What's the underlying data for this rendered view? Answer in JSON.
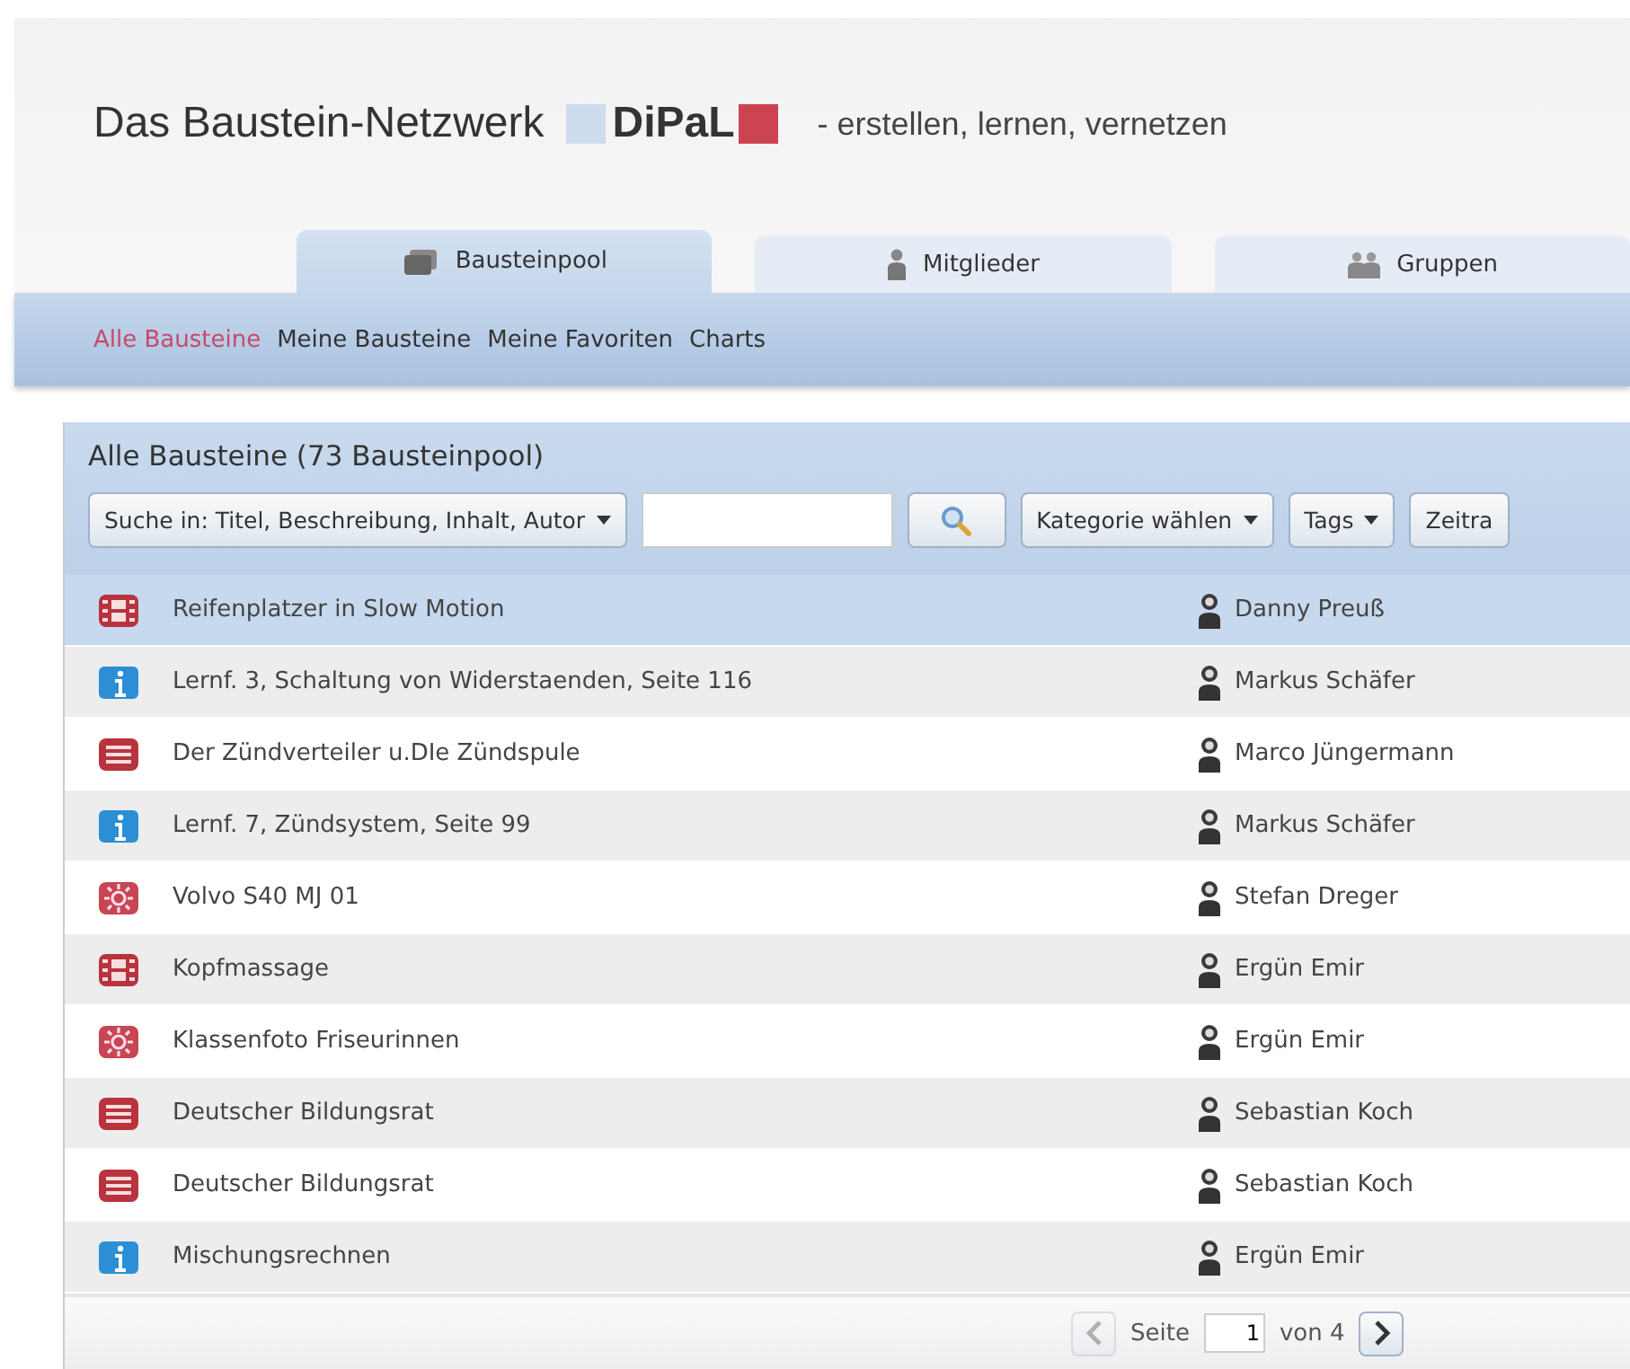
{
  "header": {
    "title": "Das Baustein-Netzwerk",
    "logo": "DiPaL",
    "slogan": "- erstellen, lernen, vernetzen"
  },
  "tabs": [
    {
      "label": "Bausteinpool",
      "kind": "pool",
      "selected": true
    },
    {
      "label": "Mitglieder",
      "kind": "member",
      "selected": false
    },
    {
      "label": "Gruppen",
      "kind": "group",
      "selected": false
    }
  ],
  "subnav": [
    {
      "label": "Alle Bausteine",
      "selected": true
    },
    {
      "label": "Meine Bausteine",
      "selected": false
    },
    {
      "label": "Meine Favoriten",
      "selected": false
    },
    {
      "label": "Charts",
      "selected": false
    }
  ],
  "panel": {
    "title": "Alle Bausteine (73 Bausteinpool)",
    "toolbar": {
      "search_scope": "Suche in: Titel, Beschreibung, Inhalt, Autor",
      "category": "Kategorie wählen",
      "tags": "Tags",
      "cut_button": "Zeitra"
    },
    "rows": [
      {
        "kind": "video",
        "title": "Reifenplatzer in Slow Motion",
        "author": "Danny Preuß",
        "selected": true
      },
      {
        "kind": "info",
        "title": "Lernf. 3, Schaltung von Widerstaenden, Seite 116",
        "author": "Markus Schäfer",
        "selected": false
      },
      {
        "kind": "text",
        "title": "Der Zündverteiler u.DIe Zündspule",
        "author": "Marco Jüngermann",
        "selected": false
      },
      {
        "kind": "info",
        "title": "Lernf. 7, Zündsystem, Seite 99",
        "author": "Markus Schäfer",
        "selected": false
      },
      {
        "kind": "image",
        "title": "Volvo S40 MJ 01",
        "author": "Stefan Dreger",
        "selected": false
      },
      {
        "kind": "video",
        "title": "Kopfmassage",
        "author": "Ergün Emir",
        "selected": false
      },
      {
        "kind": "image",
        "title": "Klassenfoto Friseurinnen",
        "author": "Ergün Emir",
        "selected": false
      },
      {
        "kind": "text",
        "title": "Deutscher Bildungsrat",
        "author": "Sebastian Koch",
        "selected": false
      },
      {
        "kind": "text",
        "title": "Deutscher Bildungsrat",
        "author": "Sebastian Koch",
        "selected": false
      },
      {
        "kind": "info",
        "title": "Mischungsrechnen",
        "author": "Ergün Emir",
        "selected": false
      }
    ],
    "pagination": {
      "label": "Seite",
      "page": "1",
      "of": "von 4",
      "prev_disabled": true,
      "next_disabled": false
    }
  }
}
